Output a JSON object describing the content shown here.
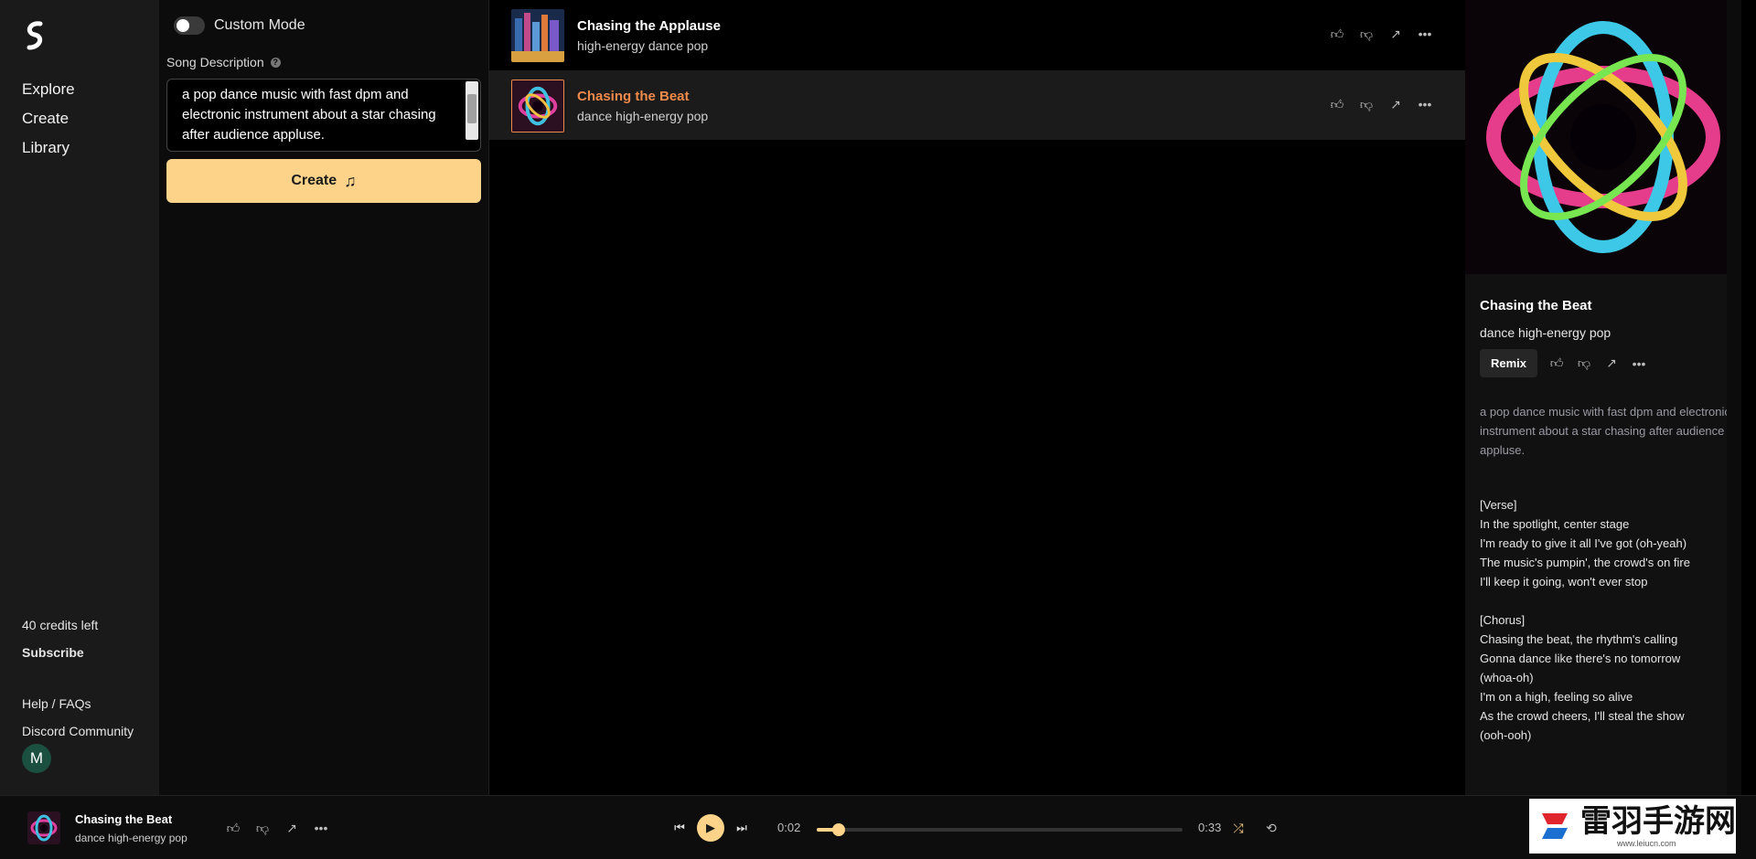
{
  "nav": {
    "links": [
      "Explore",
      "Create",
      "Library"
    ],
    "credits": "40 credits left",
    "subscribe": "Subscribe",
    "help": "Help / FAQs",
    "discord": "Discord Community",
    "avatar": "M"
  },
  "create": {
    "custom_mode_label": "Custom Mode",
    "description_label": "Song Description",
    "description_value": "a pop dance music with fast dpm and electronic instrument about a star chasing after audience appluse.",
    "create_label": "Create",
    "create_icon": "music-note-icon"
  },
  "songs": [
    {
      "title": "Chasing the Applause",
      "tags": "high-energy dance pop",
      "selected": false
    },
    {
      "title": "Chasing the Beat",
      "tags": "dance high-energy pop",
      "selected": true
    }
  ],
  "detail": {
    "title": "Chasing the Beat",
    "tags": "dance high-energy pop",
    "remix_label": "Remix",
    "description": "a pop dance music with fast dpm and electronic instrument about a star chasing after audience appluse.",
    "lyrics": "[Verse]\nIn the spotlight, center stage\nI'm ready to give it all I've got (oh-yeah)\nThe music's pumpin', the crowd's on fire\nI'll keep it going, won't ever stop\n\n[Chorus]\nChasing the beat, the rhythm's calling\nGonna dance like there's no tomorrow\n(whoa-oh)\nI'm on a high, feeling so alive\nAs the crowd cheers, I'll steal the show\n(ooh-ooh)"
  },
  "player": {
    "title": "Chasing the Beat",
    "tags": "dance high-energy pop",
    "current_time": "0:02",
    "duration": "0:33",
    "progress_fraction": 0.06
  },
  "watermark": {
    "text": "雷羽手游网",
    "url": "www.leiucn.com"
  },
  "colors": {
    "accent": "#fdd38a",
    "active_title": "#f08a4b"
  }
}
